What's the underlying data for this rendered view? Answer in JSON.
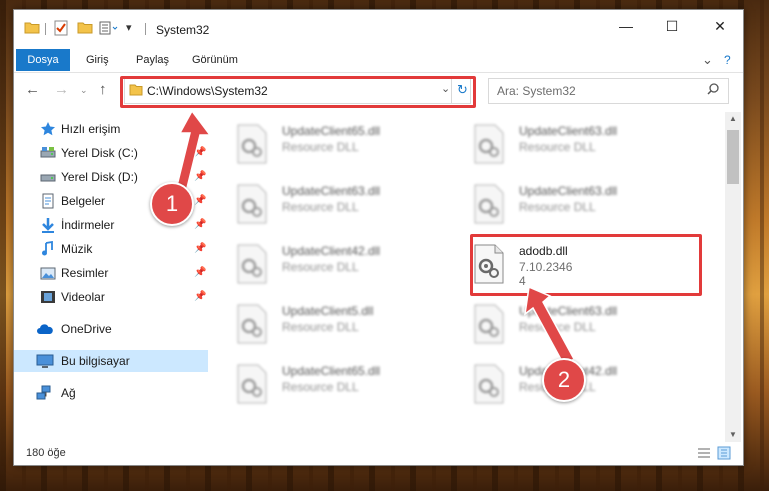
{
  "window": {
    "title": "System32",
    "minimize_glyph": "—",
    "maximize_glyph": "☐",
    "close_glyph": "✕"
  },
  "ribbon": {
    "tabs": [
      "Dosya",
      "Giriş",
      "Paylaş",
      "Görünüm"
    ],
    "expand_glyph": "⌄",
    "help_glyph": "?"
  },
  "nav": {
    "address": "C:\\Windows\\System32",
    "search_placeholder": "Ara: System32"
  },
  "sidebar": {
    "items": [
      {
        "label": "Hızlı erişim",
        "icon": "star-icon",
        "pinned": false
      },
      {
        "label": "Yerel Disk (C:)",
        "icon": "drive-icon",
        "pinned": true
      },
      {
        "label": "Yerel Disk (D:)",
        "icon": "drive-icon",
        "pinned": true
      },
      {
        "label": "Belgeler",
        "icon": "documents-icon",
        "pinned": true
      },
      {
        "label": "İndirmeler",
        "icon": "downloads-icon",
        "pinned": true
      },
      {
        "label": "Müzik",
        "icon": "music-icon",
        "pinned": true
      },
      {
        "label": "Resimler",
        "icon": "pictures-icon",
        "pinned": true
      },
      {
        "label": "Videolar",
        "icon": "videos-icon",
        "pinned": true
      },
      {
        "label": "OneDrive",
        "icon": "cloud-icon",
        "pinned": false
      },
      {
        "label": "Bu bilgisayar",
        "icon": "computer-icon",
        "pinned": false,
        "selected": true
      },
      {
        "label": "Ağ",
        "icon": "network-icon",
        "pinned": false
      }
    ]
  },
  "files": [
    {
      "name": "UpdateClient65.dll",
      "type": "Resource DLL",
      "blurred": true
    },
    {
      "name": "UpdateClient63.dll",
      "type": "Resource DLL",
      "blurred": true
    },
    {
      "name": "UpdateClient63.dll",
      "type": "Resource DLL",
      "blurred": true
    },
    {
      "name": "UpdateClient63.dll",
      "type": "Resource DLL",
      "blurred": true
    },
    {
      "name": "UpdateClient42.dll",
      "type": "Resource DLL",
      "blurred": true
    },
    {
      "name": "adodb.dll",
      "type": "7.10.2346",
      "extra": "4",
      "blurred": false
    },
    {
      "name": "UpdateClient5.dll",
      "type": "Resource DLL",
      "blurred": true
    },
    {
      "name": "UpdateClient63.dll",
      "type": "Resource DLL",
      "blurred": true
    },
    {
      "name": "UpdateClient65.dll",
      "type": "Resource DLL",
      "blurred": true
    },
    {
      "name": "UpdateClient42.dll",
      "type": "Resource DLL",
      "blurred": true
    }
  ],
  "status": {
    "item_count": "180 öğe"
  },
  "annotations": {
    "step1": "1",
    "step2": "2",
    "color": "#e23a3a"
  }
}
